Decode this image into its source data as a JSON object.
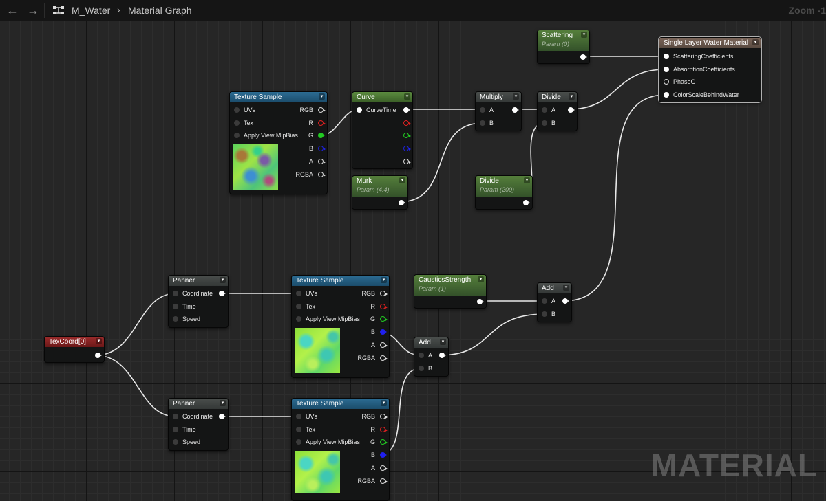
{
  "toolbar": {
    "back_icon": "←",
    "forward_icon": "→",
    "asset_name": "M_Water",
    "chevron": "›",
    "graph_name": "Material Graph",
    "zoom": "Zoom -1"
  },
  "watermark": "MATERIAL",
  "colors": {
    "texture_header": "#2c6c93",
    "function_header": "#4a4e4c",
    "param_header": "#5b8b3f",
    "texcoord_header": "#9b2b2b",
    "result_header": "#7a6559",
    "wire": "#e8e8e8"
  },
  "nodes": {
    "tex1": {
      "title": "Texture Sample",
      "inputs": [
        "UVs",
        "Tex",
        "Apply View MipBias"
      ],
      "outputs": [
        "RGB",
        "R",
        "G",
        "B",
        "A",
        "RGBA"
      ]
    },
    "curve": {
      "title": "Curve",
      "input": "CurveTime"
    },
    "multiply": {
      "title": "Multiply",
      "inputs": [
        "A",
        "B"
      ]
    },
    "divide1": {
      "title": "Divide",
      "inputs": [
        "A",
        "B"
      ]
    },
    "scattering": {
      "title": "Scattering",
      "sub": "Param (0)"
    },
    "murk": {
      "title": "Murk",
      "sub": "Param (4.4)"
    },
    "divide2": {
      "title": "Divide",
      "sub": "Param (200)"
    },
    "swm": {
      "title": "Single Layer Water Material",
      "inputs": [
        "ScatteringCoefficients",
        "AbsorptionCoefficients",
        "PhaseG",
        "ColorScaleBehindWater"
      ]
    },
    "panner1": {
      "title": "Panner",
      "inputs": [
        "Coordinate",
        "Time",
        "Speed"
      ]
    },
    "tex2": {
      "title": "Texture Sample",
      "inputs": [
        "UVs",
        "Tex",
        "Apply View MipBias"
      ],
      "outputs": [
        "RGB",
        "R",
        "G",
        "B",
        "A",
        "RGBA"
      ]
    },
    "caustics": {
      "title": "CausticsStrength",
      "sub": "Param (1)"
    },
    "add1": {
      "title": "Add",
      "inputs": [
        "A",
        "B"
      ]
    },
    "add2": {
      "title": "Add",
      "inputs": [
        "A",
        "B"
      ]
    },
    "texcoord": {
      "title": "TexCoord[0]"
    },
    "panner2": {
      "title": "Panner",
      "inputs": [
        "Coordinate",
        "Time",
        "Speed"
      ]
    },
    "tex3": {
      "title": "Texture Sample",
      "inputs": [
        "UVs",
        "Tex",
        "Apply View MipBias"
      ],
      "outputs": [
        "RGB",
        "R",
        "G",
        "B",
        "A",
        "RGBA"
      ]
    }
  }
}
